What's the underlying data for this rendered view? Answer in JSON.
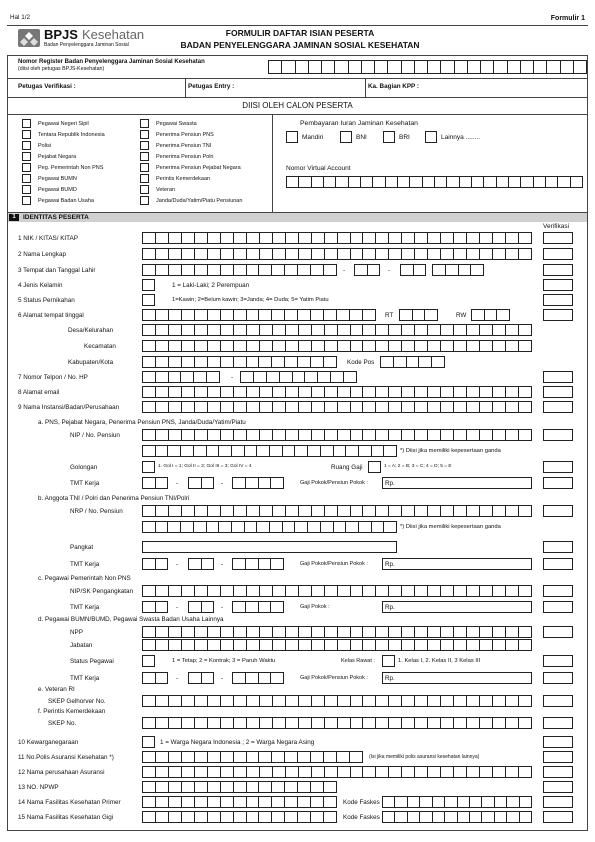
{
  "page_label": "Hal 1/2",
  "form_code": "Formulir 1",
  "brand": {
    "name": "BPJS",
    "name2": "Kesehatan",
    "tagline": "Badan Penyelenggara Jaminan Sosial"
  },
  "title1": "FORMULIR DAFTAR ISIAN PESERTA",
  "title2": "BADAN PENYELENGGARA JAMINAN SOSIAL KESEHATAN",
  "register": {
    "label": "Nomor Register Badan Penyelenggara Jaminan Sosial Kesehatan",
    "note": "(diisi oleh petugas BPJS-Kesehatan)"
  },
  "officers": {
    "verif": "Petugas Verifikasi :",
    "entry": "Petugas Entry :",
    "kabag": "Ka. Bagian KPP :"
  },
  "band": "DIISI OLEH CALON PESERTA",
  "cat_left": [
    "Pegawai Negeri Sipil",
    "Tentara Republik Indonesia",
    "Polisi",
    "Pejabat Negara",
    "Peg. Pemerintah Non PNS",
    "Pegawai BUMN",
    "Pegawai BUMD",
    "Pegawai Badan Usaha"
  ],
  "cat_mid": [
    "Pegawai Swasta",
    "Penerima Pensiun PNS",
    "Penerima Pensiun TNI",
    "Penerima Pensiun Polri",
    "Penerima Pensiun Pejabat Negara",
    "Perintis Kemerdekaan",
    "Veteran",
    "Janda/Duda/Yatim/Piatu Pensiunan"
  ],
  "payment": {
    "title": "Pembayaran Iuran Jaminan Kesehatan",
    "opts": [
      "Mandiri",
      "BNI",
      "BRI",
      "Lainnya ........"
    ],
    "va": "Nomor Virtual Account"
  },
  "section": {
    "num": "1",
    "title": "IDENTITAS PESERTA"
  },
  "verifikasi": "Verifikasi",
  "rows": {
    "r1": "1  NIK / KITAS/ KITAP",
    "r2": "2  Nama Lengkap",
    "r3": "3  Tempat dan Tanggal Lahir",
    "r4": "4  Jenis Kelamin",
    "r5": "5  Status Pernikahan",
    "r6": "6  Alamat tempat tinggal",
    "r7": "7  Nomor Telpon / No. HP",
    "r8": "8  Alamat email",
    "r9": "9  Nama Instansi/Badan/Perusahaan",
    "r10": "10 Kewarganegaraan",
    "r11": "11 No.Polis Asuransi Kesehatan *)",
    "r12": "12 Nama perusahaan Asuransi",
    "r13": "13 NO. NPWP",
    "r14": "14 Nama Fasilitas Kesehatan Primer",
    "r15": "15 Nama  Fasilitas Kesehatan Gigi"
  },
  "sex_note": "1 = Laki-Laki; 2 Perempuan",
  "marital_note": "1=Kawin; 2=Belum kawin; 3=Janda; 4= Duda; 5= Yatim Piatu",
  "rt": "RT",
  "rw": "RW",
  "addr": {
    "desa": "Desa/Kelurahan",
    "kec": "Kecamatan",
    "kab": "Kabupaten/Kota",
    "kodepos": "Kode Pos"
  },
  "dash": "-",
  "a": {
    "title": "a.  PNS, Pejabat Negara, Penerima Pensiun PNS, Janda/Duda/Yatim/Piatu",
    "nip": "NIP / No.  Pensiun",
    "note": "*) Diisi jika memiliki kepesertaan ganda",
    "golongan": "Golongan",
    "gol_note": "1. Gol I = 1;  Gol II = 2;  Gol III = 3;  Gol IV = 4",
    "ruang": "Ruang Gaji",
    "ruang_note": "1 = A;   2 = B;   3 = C;   4 = D;   5 = E",
    "tmt": "TMT Kerja",
    "gaji": "Gaji Pokok/Pensiun Pokok :",
    "rp": "Rp."
  },
  "b": {
    "title": "b.  Anggota TNI / Polri dan Penerima Pensiun TNI/Polri",
    "nrp": "NRP / No.  Pensiun",
    "note": "*) Diisi jika memiliki kepesertaan ganda",
    "pangkat": "Pangkat",
    "tmt": "TMT Kerja",
    "gaji": "Gaji Pokok/Pensiun Pokok  :",
    "rp": "Rp."
  },
  "c": {
    "title": "c.  Pegawai Pemerintah Non PNS",
    "nip": "NIP/SK Pengangkatan",
    "tmt": "TMT Kerja",
    "gaji": "Gaji Pokok :",
    "rp": "Rp."
  },
  "d": {
    "title": "d.  Pegawai BUMN/BUMD, Pegawai Swasta Badan Usaha Lainnya",
    "npp": "NPP",
    "jabatan": "Jabatan",
    "status": "Status Pegawai",
    "status_note": "1 = Tetap;     2 = Kontrak;     3 = Paruh Waktu",
    "kelas": "Kelas Rawat :",
    "kelas_note": "1. Kelas I, 2. Kelas II, 3 Kelas III",
    "tmt": "TMT Kerja",
    "gaji": "Gaji Pokok/Pensiun Pokok :",
    "rp": "Rp."
  },
  "e": {
    "title": "e.  Veteran RI",
    "skep": "SKEP Gelhorver  No."
  },
  "f": {
    "title": "f.   Perintis Kemerdekaan",
    "skep": "SKEP No."
  },
  "citizen_note": "1 = Warga Negara Indonesia ;   2 = Warga Negara Asing",
  "polis_note": "(Isi jika memiliki polis asuransi kesehatan lainnya)",
  "kode_faskes": "Kode Faskes"
}
